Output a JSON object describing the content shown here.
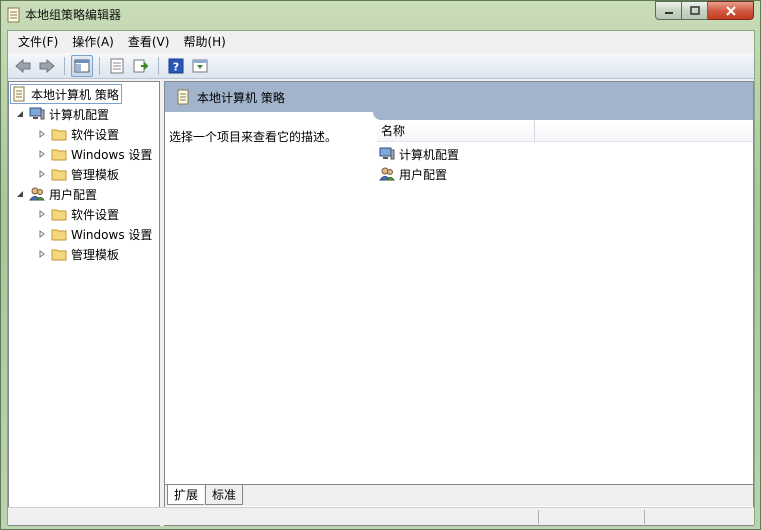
{
  "window": {
    "title": "本地组策略编辑器"
  },
  "menu": [
    "文件(F)",
    "操作(A)",
    "查看(V)",
    "帮助(H)"
  ],
  "toolbar": {
    "buttons": [
      "back-arrow-icon",
      "forward-arrow-icon",
      "show-hide-tree-icon",
      "properties-icon",
      "export-list-icon",
      "help-icon",
      "filter-icon"
    ]
  },
  "tree": {
    "root": "本地计算机 策略",
    "computer_config": {
      "label": "计算机配置",
      "children": [
        "软件设置",
        "Windows 设置",
        "管理模板"
      ]
    },
    "user_config": {
      "label": "用户配置",
      "children": [
        "软件设置",
        "Windows 设置",
        "管理模板"
      ]
    }
  },
  "right_pane": {
    "header": "本地计算机 策略",
    "description": "选择一个项目来查看它的描述。",
    "column_name": "名称",
    "items": [
      "计算机配置",
      "用户配置"
    ]
  },
  "tabs": [
    "扩展",
    "标准"
  ]
}
